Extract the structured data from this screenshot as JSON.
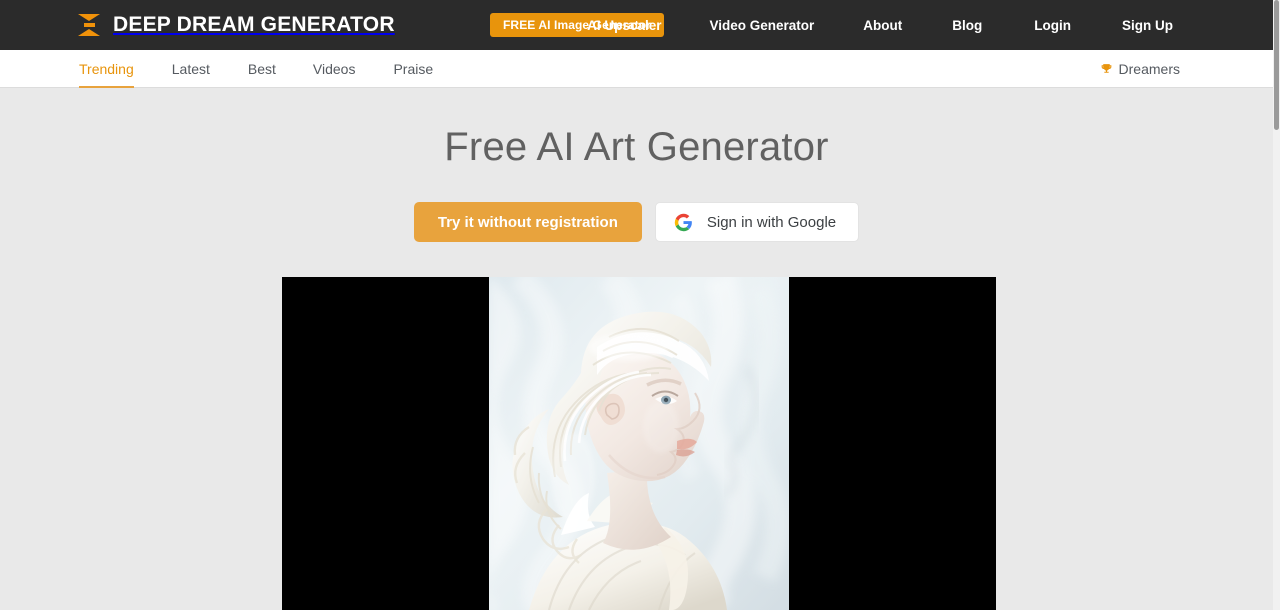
{
  "header": {
    "logo_icon": "hourglass-logo-icon",
    "brand": "DEEP DREAM GENERATOR",
    "cta_label": "FREE AI Image Generator",
    "accent_color": "#e8940c",
    "background_color": "#2b2b2b",
    "nav": [
      {
        "label": "AI Upscaler"
      },
      {
        "label": "Video Generator"
      },
      {
        "label": "About"
      },
      {
        "label": "Blog"
      },
      {
        "label": "Login"
      },
      {
        "label": "Sign Up"
      }
    ]
  },
  "subnav": {
    "background_color": "#ffffff",
    "active_color": "#e8940c",
    "tabs": [
      {
        "label": "Trending",
        "active": true
      },
      {
        "label": "Latest",
        "active": false
      },
      {
        "label": "Best",
        "active": false
      },
      {
        "label": "Videos",
        "active": false
      },
      {
        "label": "Praise",
        "active": false
      }
    ],
    "dreamers": {
      "label": "Dreamers",
      "icon": "trophy-icon",
      "icon_color": "#e8940c"
    }
  },
  "main": {
    "background_color": "#e9e9e9",
    "title": "Free AI Art Generator",
    "title_color": "#616161",
    "buttons": {
      "try_label": "Try it without registration",
      "try_color": "#e8a33d",
      "google_label": "Sign in with Google",
      "google_icon": "google-g-icon"
    },
    "featured_image": {
      "alt": "White porcelain sculpture portrait of a woman in profile with flowing wavy hair",
      "letterbox_color": "#000000"
    }
  },
  "scrollbar": {
    "thumb_color": "#9a9a9a",
    "track_color": "#f1f1f1"
  }
}
